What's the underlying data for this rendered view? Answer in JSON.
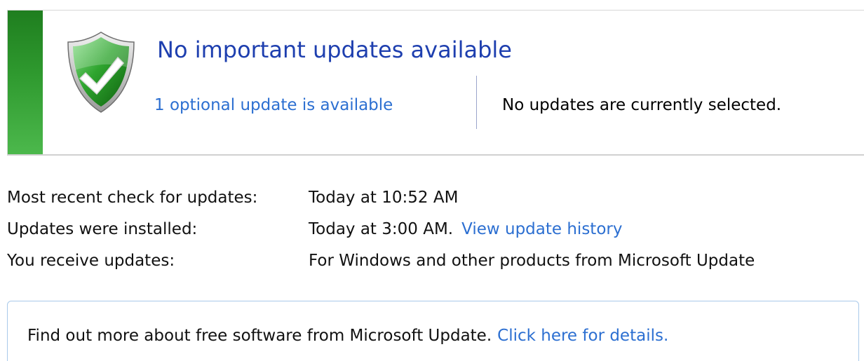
{
  "status": {
    "title": "No important updates available",
    "optional_link": "1 optional update is available",
    "selection_text": "No updates are currently selected.",
    "bar_color": "#2f9a2f",
    "icon": "shield-check-icon"
  },
  "info": {
    "rows": [
      {
        "label": "Most recent check for updates:",
        "value": "Today at 10:52 AM"
      },
      {
        "label": "Updates were installed:",
        "value": "Today at 3:00 AM.",
        "link": "View update history"
      },
      {
        "label": "You receive updates:",
        "value": "For Windows and other products from Microsoft Update"
      }
    ]
  },
  "banner": {
    "text": "Find out more about free software from Microsoft Update.",
    "link": "Click here for details."
  },
  "colors": {
    "link": "#2c6fd1",
    "title": "#1e3faf"
  }
}
